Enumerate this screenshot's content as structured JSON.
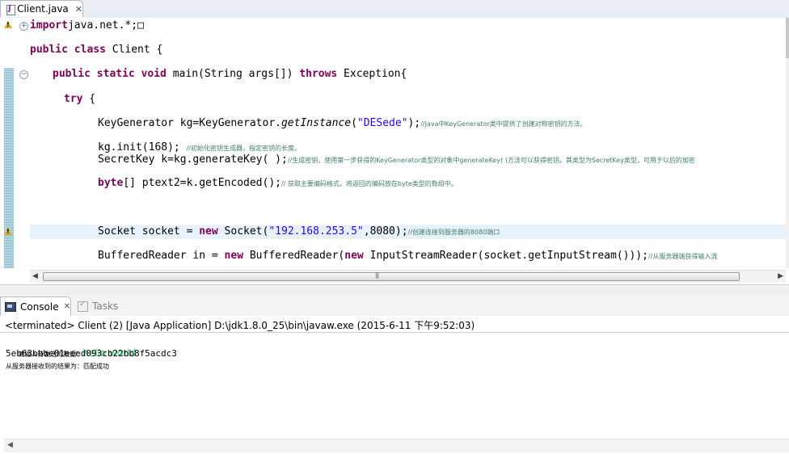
{
  "editor": {
    "tab_label": "Client.java",
    "tab_close": "✕",
    "lines": [
      {
        "parts": [
          [
            "kw",
            "import"
          ],
          [
            "",
            "java.net.*;"
          ],
          [
            "",
            "□"
          ]
        ]
      },
      {
        "parts": [
          [
            "kw",
            "public class"
          ],
          [
            "",
            " Client {"
          ]
        ]
      },
      {
        "parts": [
          [
            "kw",
            "public static void"
          ],
          [
            "",
            " main(String args[]) "
          ],
          [
            "kw",
            "throws"
          ],
          [
            "",
            " Exception{"
          ]
        ]
      },
      {
        "parts": [
          [
            "kw",
            "try"
          ],
          [
            "",
            " {"
          ]
        ]
      },
      {
        "parts": [
          [
            "",
            "KeyGenerator kg=KeyGenerator."
          ],
          [
            "it",
            "getInstance"
          ],
          [
            "",
            "("
          ],
          [
            "str",
            "\"DESede\""
          ],
          [
            "",
            ");"
          ],
          [
            "cm",
            "//Java中KeyGenerator类中提供了创建对称密钥的方法。"
          ]
        ]
      },
      {
        "parts": [
          [
            "",
            "kg.init(168); "
          ],
          [
            "cm",
            "//初始化密钥生成器，指定密钥的长度。"
          ]
        ]
      },
      {
        "parts": [
          [
            "",
            "SecretKey k=kg.generateKey( );"
          ],
          [
            "cm",
            "//生成密钥，使用第一步获得的KeyGenerator类型的对象中generateKey( )方法可以获得密钥。其类型为SecretKey类型，可用于以后的加密"
          ]
        ]
      },
      {
        "parts": [
          [
            "kw",
            "byte"
          ],
          [
            "",
            "[] ptext2=k.getEncoded();"
          ],
          [
            "cm",
            "// 获取主要编码格式，将返回的编码放在byte类型的数组中。"
          ]
        ]
      },
      {
        "parts": [
          [
            "",
            "Socket socket = "
          ],
          [
            "kw",
            "new"
          ],
          [
            "",
            " Socket("
          ],
          [
            "str",
            "\"192.168.253.5\""
          ],
          [
            "",
            ",8080);"
          ],
          [
            "cm",
            "//创建连接到服务器的8080端口"
          ]
        ]
      },
      {
        "parts": [
          [
            "",
            "BufferedReader in = "
          ],
          [
            "kw",
            "new"
          ],
          [
            "",
            " BufferedReader("
          ],
          [
            "kw",
            "new"
          ],
          [
            "",
            " InputStreamReader(socket.getInputStream()));"
          ],
          [
            "cm",
            "//从服务器端获得输入流"
          ]
        ]
      }
    ]
  },
  "console": {
    "tab_console": "Console",
    "tab_tasks": "Tasks",
    "header": "<terminated> Client (2) [Java Application] D:\\jdk1.8.0_25\\bin\\javaw.exe (2015-6-11 下午9:52:03)",
    "prompt": "请输入待发送的数据：",
    "user_input": "hello world",
    "hex_line": "5eb63bbbe01eeed093cb22bb8f5acdc3",
    "result_line": "从服务器接收到的结果为：匹配成功"
  }
}
